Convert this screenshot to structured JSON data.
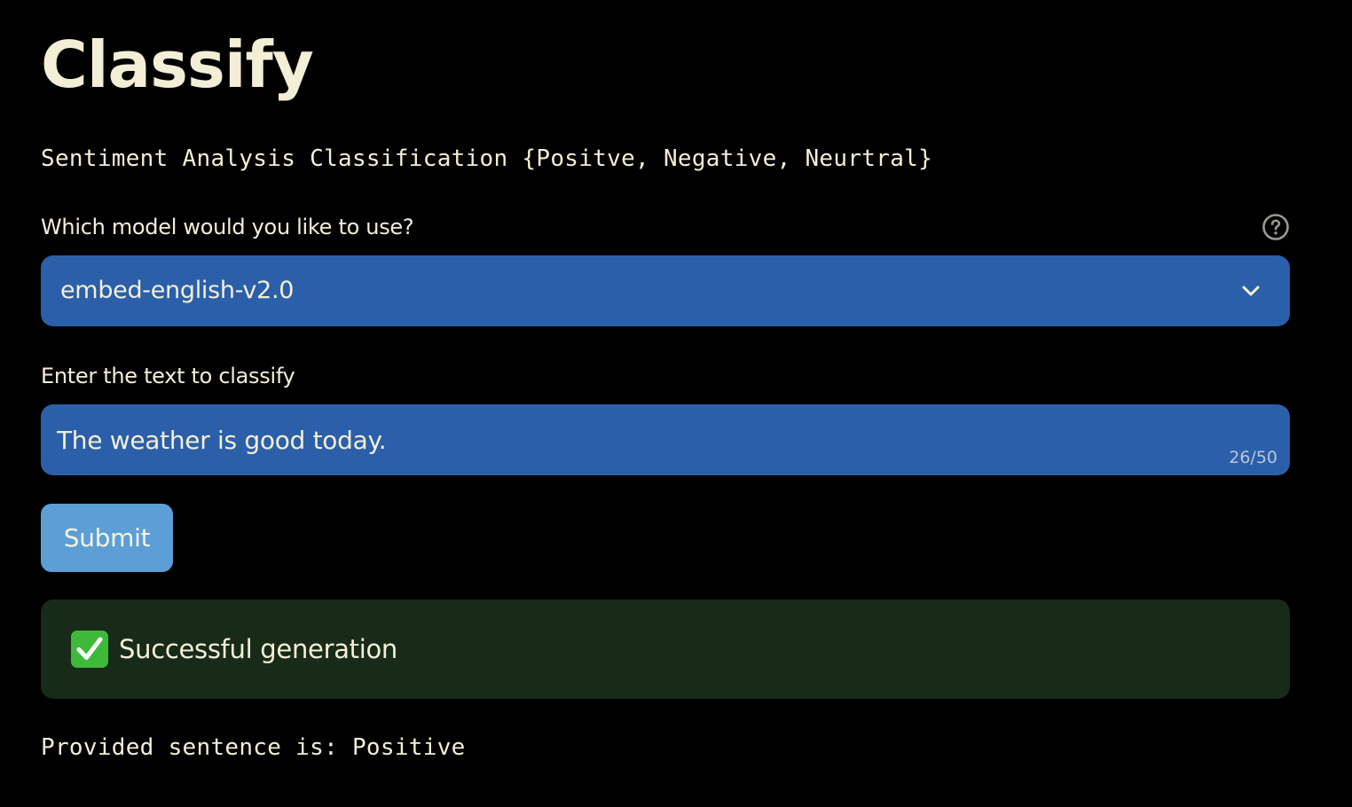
{
  "page": {
    "title": "Classify",
    "subtitle": "Sentiment Analysis Classification {Positve, Negative, Neurtral}"
  },
  "model_select": {
    "label": "Which model would you like to use?",
    "selected": "embed-english-v2.0",
    "help_icon": "question-circle-icon",
    "chevron_icon": "chevron-down-icon"
  },
  "text_input": {
    "label": "Enter the text to classify",
    "value": "The weather is good today.",
    "counter": "26/50"
  },
  "submit": {
    "label": "Submit"
  },
  "alert": {
    "icon": "check-box-icon",
    "text": "Successful generation"
  },
  "result": {
    "text": "Provided sentence is: Positive"
  },
  "colors": {
    "background": "#000000",
    "text": "#f3efd6",
    "field": "#2b5faa",
    "button": "#5c9fd7",
    "success_bg": "#172b18",
    "success_icon": "#3fb93a"
  }
}
